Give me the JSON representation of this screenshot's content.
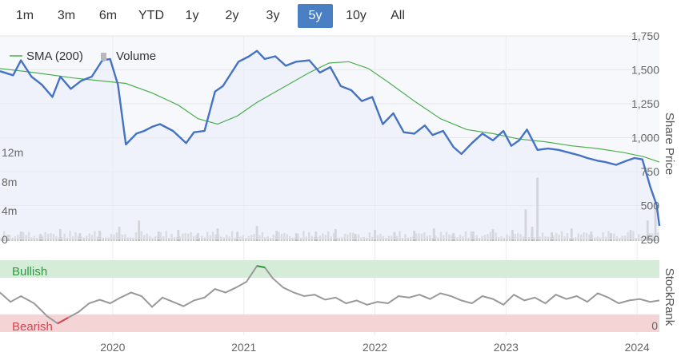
{
  "range_selector": {
    "buttons": [
      "1m",
      "3m",
      "6m",
      "YTD",
      "1y",
      "2y",
      "3y",
      "5y",
      "10y",
      "All"
    ],
    "active": "5y"
  },
  "legend": {
    "sma_label": "SMA (200)",
    "volume_label": "Volume"
  },
  "colors": {
    "price_line": "#4472c4",
    "sma_line": "#4caf50",
    "volume_bar": "#c8c8c8",
    "bullish_band": "#d4ecd8",
    "bearish_band": "#f5d4d6",
    "bullish_text": "#2e9a3e",
    "bearish_text": "#d9434f",
    "stockrank_line": "#999999",
    "active_button": "#4a7fc4"
  },
  "chart_data": [
    {
      "type": "line",
      "ylabel": "Share Price",
      "y_ticks": [
        "1,750",
        "1,500",
        "1,250",
        "1,000",
        "750",
        "500",
        "250"
      ],
      "ylim": [
        250,
        1750
      ],
      "x_ticks": [
        "2020",
        "2021",
        "2022",
        "2023",
        "2024"
      ],
      "xlim": [
        2019.14,
        2024.17
      ],
      "grid": true,
      "series": [
        {
          "name": "Share Price",
          "x": [
            2019.14,
            2019.24,
            2019.3,
            2019.38,
            2019.46,
            2019.54,
            2019.6,
            2019.68,
            2019.76,
            2019.84,
            2019.92,
            2019.98,
            2020.04,
            2020.1,
            2020.18,
            2020.24,
            2020.3,
            2020.36,
            2020.46,
            2020.56,
            2020.62,
            2020.7,
            2020.78,
            2020.84,
            2020.9,
            2020.96,
            2021.04,
            2021.1,
            2021.16,
            2021.24,
            2021.32,
            2021.4,
            2021.5,
            2021.58,
            2021.66,
            2021.74,
            2021.82,
            2021.9,
            2021.98,
            2022.06,
            2022.14,
            2022.22,
            2022.3,
            2022.38,
            2022.44,
            2022.52,
            2022.6,
            2022.66,
            2022.74,
            2022.82,
            2022.9,
            2022.98,
            2023.04,
            2023.1,
            2023.16,
            2023.24,
            2023.32,
            2023.4,
            2023.48,
            2023.56,
            2023.62,
            2023.7,
            2023.76,
            2023.84,
            2023.92,
            2023.98,
            2024.04,
            2024.1,
            2024.15,
            2024.17
          ],
          "values": [
            1490,
            1460,
            1570,
            1450,
            1390,
            1300,
            1450,
            1360,
            1420,
            1450,
            1570,
            1580,
            1390,
            950,
            1030,
            1050,
            1080,
            1100,
            1050,
            960,
            1040,
            1050,
            1340,
            1380,
            1470,
            1560,
            1600,
            1640,
            1580,
            1600,
            1530,
            1560,
            1570,
            1480,
            1520,
            1380,
            1350,
            1270,
            1300,
            1100,
            1180,
            1040,
            1030,
            1090,
            1020,
            1050,
            930,
            880,
            960,
            1030,
            980,
            1050,
            940,
            980,
            1060,
            910,
            920,
            910,
            890,
            870,
            850,
            830,
            820,
            800,
            830,
            850,
            840,
            640,
            500,
            350
          ]
        },
        {
          "name": "SMA (200)",
          "x": [
            2019.14,
            2019.4,
            2019.7,
            2019.9,
            2020.1,
            2020.3,
            2020.5,
            2020.65,
            2020.8,
            2020.95,
            2021.1,
            2021.3,
            2021.5,
            2021.65,
            2021.8,
            2021.95,
            2022.1,
            2022.3,
            2022.5,
            2022.7,
            2022.9,
            2023.1,
            2023.3,
            2023.5,
            2023.7,
            2023.9,
            2024.05,
            2024.17
          ],
          "values": [
            1510,
            1480,
            1440,
            1420,
            1400,
            1330,
            1240,
            1140,
            1100,
            1160,
            1260,
            1370,
            1480,
            1550,
            1560,
            1510,
            1410,
            1270,
            1140,
            1060,
            1030,
            990,
            970,
            940,
            920,
            890,
            860,
            820
          ]
        }
      ]
    },
    {
      "type": "bar",
      "ylabel": "Volume",
      "y_ticks": [
        "12m",
        "8m",
        "4m",
        "0"
      ],
      "ylim": [
        0,
        12
      ],
      "series": [
        {
          "name": "Volume",
          "x": [
            2019.2,
            2019.3,
            2019.45,
            2019.6,
            2019.75,
            2019.9,
            2020.05,
            2020.2,
            2020.35,
            2020.5,
            2020.65,
            2020.8,
            2020.95,
            2021.1,
            2021.25,
            2021.4,
            2021.55,
            2021.7,
            2021.85,
            2022.0,
            2022.15,
            2022.3,
            2022.45,
            2022.6,
            2022.75,
            2022.9,
            2023.05,
            2023.15,
            2023.2,
            2023.24,
            2023.35,
            2023.5,
            2023.65,
            2023.8,
            2023.95,
            2024.08,
            2024.14
          ],
          "values": [
            0.8,
            1.2,
            0.9,
            1.5,
            1.0,
            1.3,
            1.8,
            2.6,
            1.2,
            1.4,
            1.0,
            1.6,
            1.1,
            1.9,
            1.3,
            1.0,
            1.2,
            1.5,
            0.9,
            1.4,
            1.1,
            1.3,
            1.6,
            1.0,
            1.2,
            1.5,
            1.4,
            4.0,
            1.8,
            8.0,
            1.1,
            1.6,
            1.2,
            1.0,
            1.4,
            2.6,
            4.2
          ]
        }
      ]
    },
    {
      "type": "line",
      "ylabel": "StockRank",
      "y_ticks": [
        "0"
      ],
      "ylim": [
        0,
        100
      ],
      "bands": [
        "Bullish",
        "Bearish"
      ],
      "series": [
        {
          "name": "StockRank",
          "x": [
            2019.14,
            2019.22,
            2019.3,
            2019.4,
            2019.5,
            2019.58,
            2019.66,
            2019.74,
            2019.82,
            2019.9,
            2019.98,
            2020.06,
            2020.14,
            2020.22,
            2020.3,
            2020.38,
            2020.46,
            2020.54,
            2020.62,
            2020.7,
            2020.78,
            2020.86,
            2020.94,
            2021.02,
            2021.1,
            2021.16,
            2021.22,
            2021.3,
            2021.38,
            2021.46,
            2021.54,
            2021.62,
            2021.7,
            2021.78,
            2021.86,
            2021.94,
            2022.02,
            2022.1,
            2022.18,
            2022.26,
            2022.34,
            2022.42,
            2022.5,
            2022.58,
            2022.66,
            2022.74,
            2022.82,
            2022.9,
            2022.98,
            2023.06,
            2023.14,
            2023.22,
            2023.3,
            2023.38,
            2023.46,
            2023.54,
            2023.62,
            2023.7,
            2023.78,
            2023.86,
            2023.94,
            2024.02,
            2024.1,
            2024.17
          ],
          "values": [
            55,
            42,
            50,
            40,
            22,
            12,
            20,
            28,
            40,
            45,
            40,
            48,
            55,
            50,
            35,
            48,
            42,
            36,
            44,
            48,
            60,
            55,
            62,
            70,
            92,
            90,
            75,
            62,
            55,
            50,
            52,
            45,
            48,
            40,
            44,
            38,
            42,
            40,
            50,
            48,
            52,
            46,
            54,
            50,
            44,
            40,
            50,
            46,
            38,
            52,
            44,
            48,
            40,
            52,
            46,
            50,
            42,
            54,
            48,
            40,
            44,
            46,
            42,
            44
          ]
        }
      ]
    }
  ],
  "x_axis_labels": [
    "2020",
    "2021",
    "2022",
    "2023",
    "2024"
  ]
}
